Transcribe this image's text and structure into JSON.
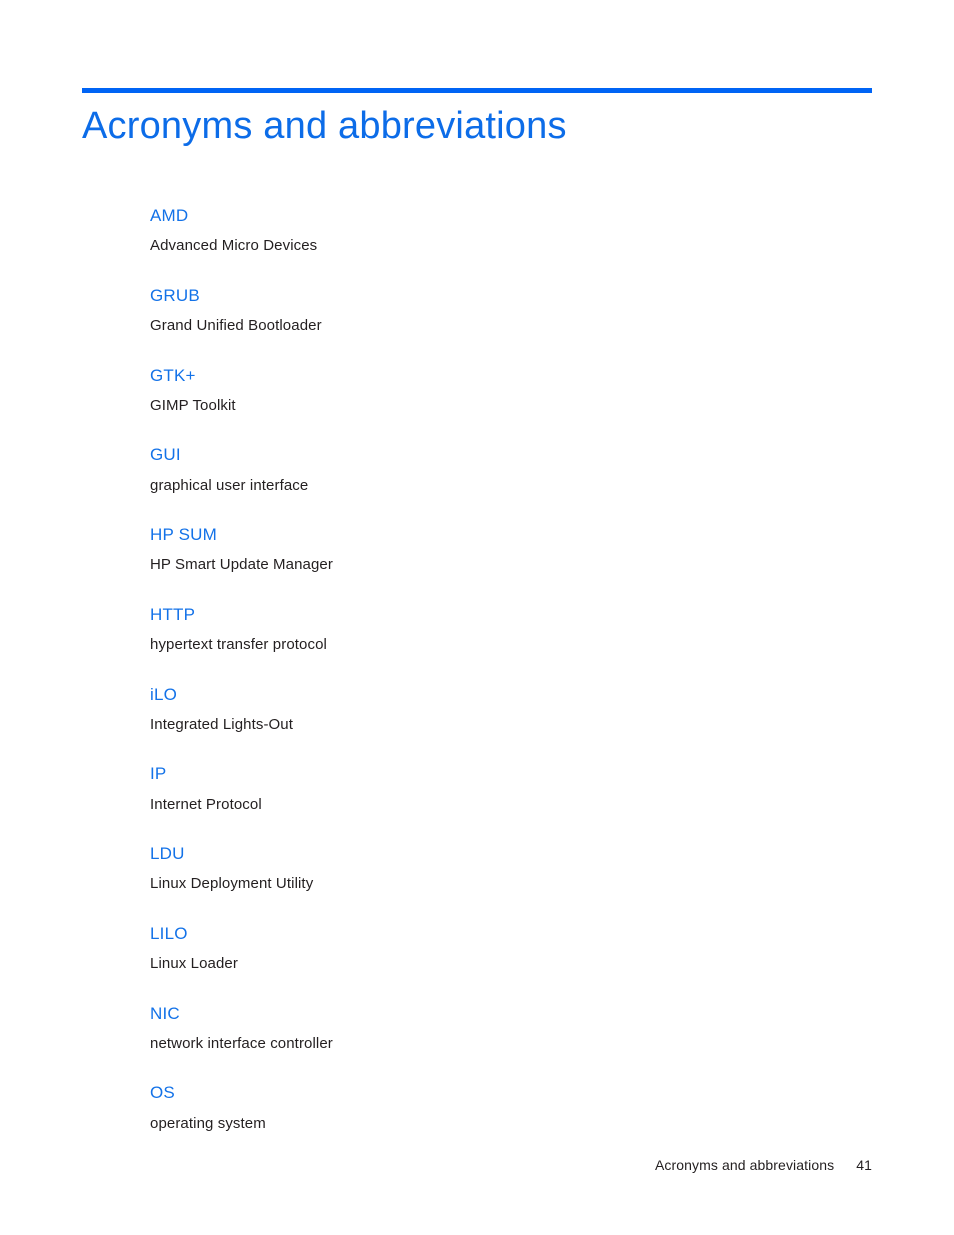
{
  "heading": {
    "title": "Acronyms and abbreviations",
    "rule_color": "#0064f5",
    "title_color": "#0c6ce8"
  },
  "glossary": {
    "entries": [
      {
        "term": "AMD",
        "definition": "Advanced Micro Devices"
      },
      {
        "term": "GRUB",
        "definition": "Grand Unified Bootloader"
      },
      {
        "term": "GTK+",
        "definition": "GIMP Toolkit"
      },
      {
        "term": "GUI",
        "definition": "graphical user interface"
      },
      {
        "term": "HP SUM",
        "definition": "HP Smart Update Manager"
      },
      {
        "term": "HTTP",
        "definition": "hypertext transfer protocol"
      },
      {
        "term": "iLO",
        "definition": "Integrated Lights-Out"
      },
      {
        "term": "IP",
        "definition": "Internet Protocol"
      },
      {
        "term": "LDU",
        "definition": "Linux Deployment Utility"
      },
      {
        "term": "LILO",
        "definition": "Linux Loader"
      },
      {
        "term": "NIC",
        "definition": "network interface controller"
      },
      {
        "term": "OS",
        "definition": "operating system"
      }
    ]
  },
  "footer": {
    "label": "Acronyms and abbreviations",
    "page_number": "41"
  }
}
